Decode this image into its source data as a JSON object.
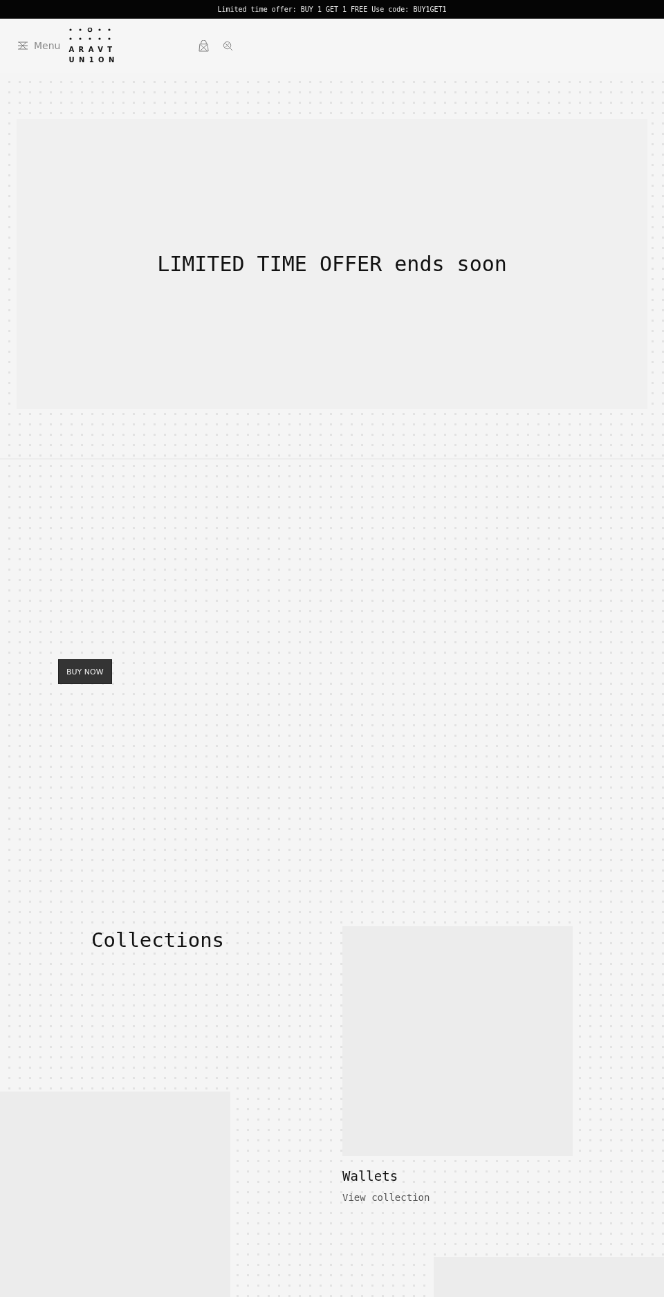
{
  "announcement": "Limited time offer: BUY 1 GET 1 FREE Use code: BUY1GET1",
  "header": {
    "menu_label": "Menu",
    "logo_lines": [
      "ARAVT",
      "UN1ON"
    ]
  },
  "hero": {
    "title": "LIMITED TIME OFFER ends soon"
  },
  "promo": {
    "button": "BUY NOW"
  },
  "collections": {
    "title": "Collections",
    "items": [
      {
        "name": "Wallets",
        "link": "View collection"
      }
    ]
  }
}
